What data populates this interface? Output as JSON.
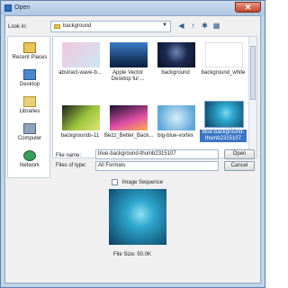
{
  "window": {
    "title": "Open",
    "close_glyph": "✕"
  },
  "toolbar": {
    "look_in_label": "Look in:",
    "look_in_value": "background",
    "dropdown_arrow": "▼",
    "back_glyph": "◀",
    "up_glyph": "↑",
    "new_folder_glyph": "✱",
    "views_glyph": "▦"
  },
  "places": [
    {
      "label": "Recent Places",
      "icon": "recent-places-icon"
    },
    {
      "label": "Desktop",
      "icon": "desktop-icon"
    },
    {
      "label": "Libraries",
      "icon": "libraries-icon"
    },
    {
      "label": "Computer",
      "icon": "computer-icon"
    },
    {
      "label": "Network",
      "icon": "network-icon"
    }
  ],
  "files": [
    {
      "label": "abstract-wave-b...",
      "colors": [
        "#f3c6dc",
        "#cde6f5"
      ]
    },
    {
      "label": "Apple Vector Desktop ful ...",
      "colors": [
        "#0a1d3a",
        "#3a7bc8"
      ]
    },
    {
      "label": "background",
      "colors": [
        "#0a0f24",
        "#6f86b5"
      ]
    },
    {
      "label": "background_white",
      "colors": [
        "#ffffff",
        "#f2f2f2"
      ]
    },
    {
      "label": "backgrounds-11",
      "colors": [
        "#1e1e1e",
        "#9cc63c"
      ]
    },
    {
      "label": "Bezz_Better_Back...",
      "colors": [
        "#15122e",
        "#e34fa8"
      ]
    },
    {
      "label": "big-blue-vortex",
      "colors": [
        "#5fa8d8",
        "#d6eefa"
      ]
    },
    {
      "label": "blue-background-thumb2315107",
      "colors": [
        "#0b3e5e",
        "#2ea7cf"
      ],
      "selected": true
    }
  ],
  "form": {
    "file_name_label": "File name:",
    "file_name_value": "blue-background-thumb2315107",
    "files_of_type_label": "Files of type:",
    "files_of_type_value": "All Formats",
    "open_label": "Open",
    "cancel_label": "Cancel"
  },
  "preview": {
    "image_sequence_label": "Image Sequence",
    "file_size": "File Size: 50.0K"
  }
}
